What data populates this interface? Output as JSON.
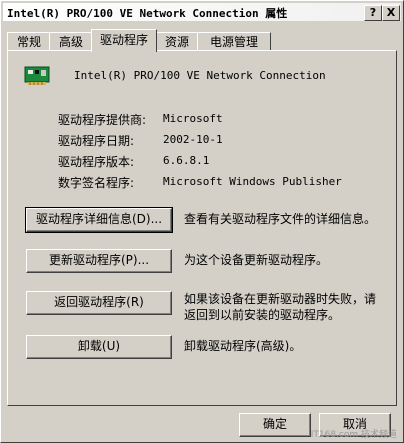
{
  "window": {
    "title": "Intel(R) PRO/100 VE Network Connection 属性",
    "help_label": "?",
    "close_label": "X"
  },
  "tabs": [
    {
      "label": "常规",
      "active": false
    },
    {
      "label": "高级",
      "active": false
    },
    {
      "label": "驱动程序",
      "active": true
    },
    {
      "label": "资源",
      "active": false
    },
    {
      "label": "电源管理",
      "active": false
    }
  ],
  "device": {
    "name": "Intel(R) PRO/100 VE Network Connection",
    "icon": "network-card-icon"
  },
  "info": [
    {
      "label": "驱动程序提供商:",
      "value": "Microsoft"
    },
    {
      "label": "驱动程序日期:",
      "value": "2002-10-1"
    },
    {
      "label": "驱动程序版本:",
      "value": "6.6.8.1"
    },
    {
      "label": "数字签名程序:",
      "value": "Microsoft Windows Publisher"
    }
  ],
  "actions": [
    {
      "button": "驱动程序详细信息(D)...",
      "desc": "查看有关驱动程序文件的详细信息。"
    },
    {
      "button": "更新驱动程序(P)...",
      "desc": "为这个设备更新驱动程序。"
    },
    {
      "button": "返回驱动程序(R)",
      "desc": "如果该设备在更新驱动器时失败，请返回到以前安装的驱动程序。"
    },
    {
      "button": "卸载(U)",
      "desc": "卸载驱动程序(高级)。"
    }
  ],
  "footer": {
    "ok_label": "确定",
    "cancel_label": "取消"
  },
  "watermark": "IT168.com 技术频道"
}
